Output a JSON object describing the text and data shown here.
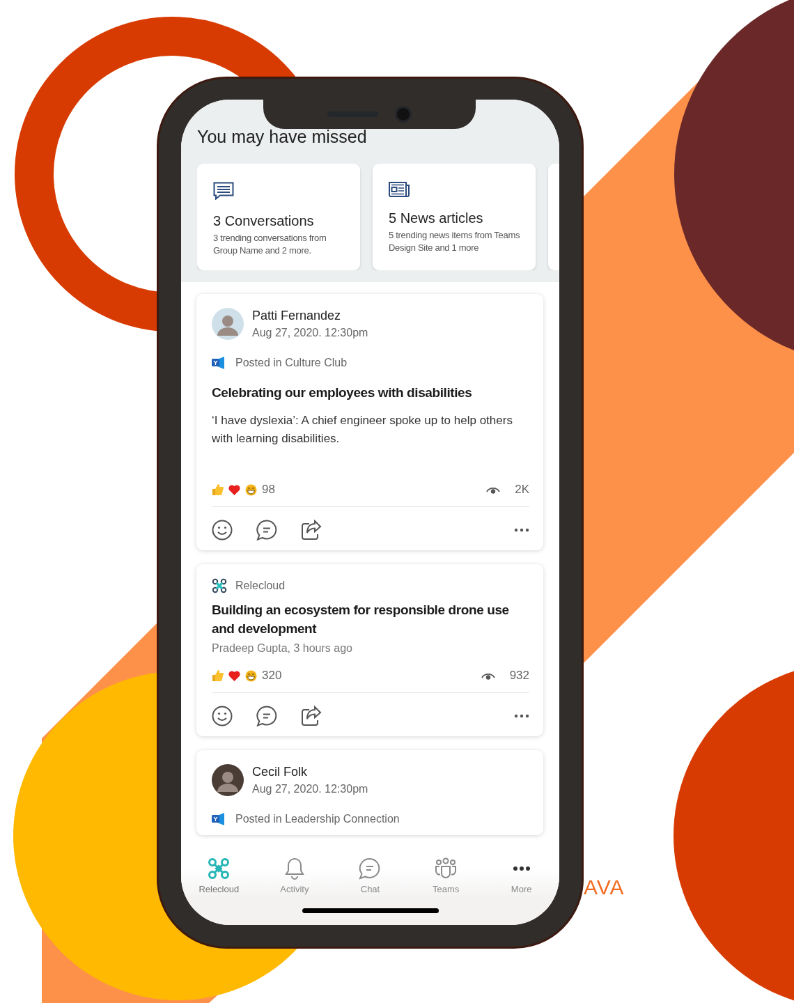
{
  "missed": {
    "title": "You may have missed",
    "cards": [
      {
        "kind": "conversations",
        "title": "3 Conversations",
        "text": "3 trending conversations from Group Name and 2 more."
      },
      {
        "kind": "news",
        "title": "5 News articles",
        "text": "5 trending news items from Teams Design Site and 1 more"
      }
    ]
  },
  "posts": [
    {
      "kind": "person",
      "author": "Patti Fernandez",
      "time": "Aug 27, 2020. 12:30pm",
      "posted_in": "Posted in Culture Club",
      "title": "Celebrating our employees with disabilities",
      "body": "‘I have dyslexia’: A chief engineer spoke up to help others with learning disabilities.",
      "reactions": "98",
      "views": "2K"
    },
    {
      "kind": "source",
      "source": "Relecloud",
      "title": "Building an ecosystem for responsible drone use and development",
      "byline": "Pradeep Gupta, 3 hours ago",
      "reactions": "320",
      "views": "932"
    },
    {
      "kind": "person",
      "author": "Cecil Folk",
      "time": "Aug 27, 2020. 12:30pm",
      "posted_in": "Posted in Leadership Connection"
    }
  ],
  "nav": [
    {
      "label": "Relecloud",
      "kind": "drone",
      "selected": true
    },
    {
      "label": "Activity",
      "kind": "bell",
      "selected": false
    },
    {
      "label": "Chat",
      "kind": "chat",
      "selected": false
    },
    {
      "label": "Teams",
      "kind": "teams",
      "selected": false
    },
    {
      "label": "More",
      "kind": "more",
      "selected": false
    }
  ],
  "brand": "AVA"
}
